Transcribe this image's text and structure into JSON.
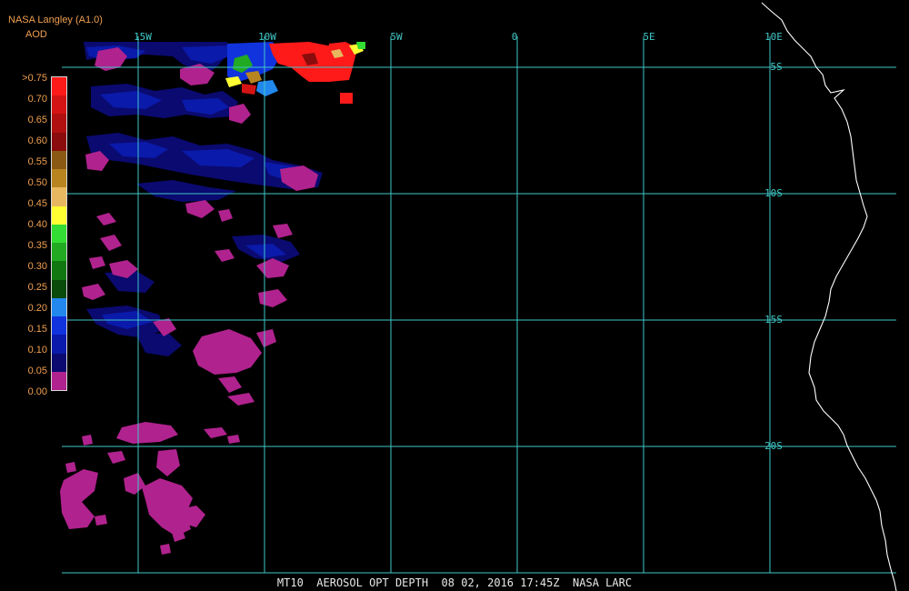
{
  "header": {
    "producer": "NASA Langley (A1.0)",
    "quantity": "AOD"
  },
  "legend": {
    "labels": [
      ">0.75",
      "0.70",
      "0.65",
      "0.60",
      "0.55",
      "0.50",
      "0.45",
      "0.40",
      "0.35",
      "0.30",
      "0.25",
      "0.20",
      "0.15",
      "0.10",
      "0.05",
      "0.00"
    ],
    "colors": [
      "#ff1a1a",
      "#d41414",
      "#b01010",
      "#8a0c0c",
      "#8a5a14",
      "#b88420",
      "#e8b860",
      "#ffff33",
      "#33dd33",
      "#22aa22",
      "#117711",
      "#0a4a0a",
      "#2288ee",
      "#1133dd",
      "#0a1aaa",
      "#0a0a70",
      "#b0228e"
    ]
  },
  "map": {
    "longitude_labels": [
      "15W",
      "10W",
      "5W",
      "0",
      "5E",
      "10E"
    ],
    "latitude_labels": [
      "5S",
      "10S",
      "15S",
      "20S"
    ],
    "colors": {
      "grid": "#3fc7c7",
      "coastline": "#ffffff"
    }
  },
  "footer": {
    "parts": [
      "MT10",
      "AEROSOL OPT DEPTH",
      "08 02, 2016 17:45Z",
      "NASA LARC"
    ]
  }
}
